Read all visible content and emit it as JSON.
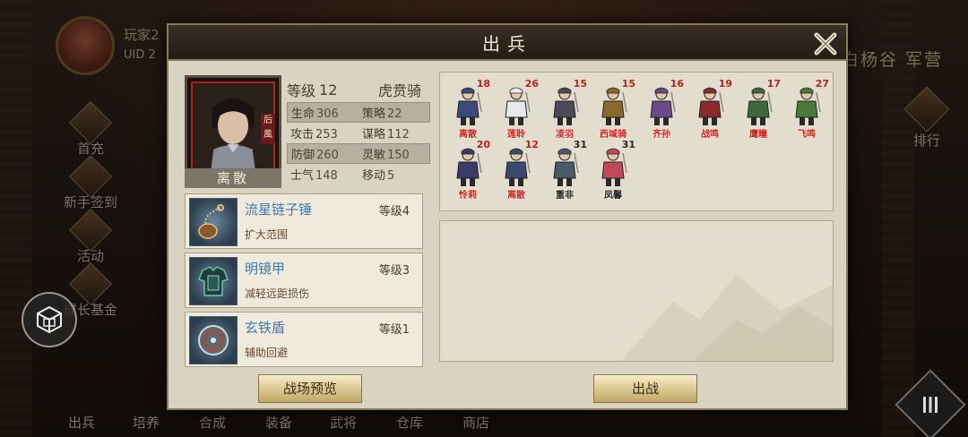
{
  "background": {
    "player_name": "玩家2",
    "player_uid": "UID 2",
    "location_title": "白杨谷  军营",
    "rank_label": "排行",
    "left_menu": [
      "首充",
      "新手签到",
      "活动",
      "成长基金"
    ],
    "bottom_menu": [
      "出兵",
      "培养",
      "合成",
      "装备",
      "武将",
      "仓库",
      "商店"
    ]
  },
  "dialog": {
    "title": "出兵",
    "close_label": "×"
  },
  "general": {
    "name": "离散",
    "level_label": "等级",
    "level": "12",
    "unit_class": "虎贲骑",
    "portrait_tag": "后風",
    "stats": [
      {
        "k": "生命",
        "v": "306",
        "k2": "策略",
        "v2": "22",
        "shaded": true
      },
      {
        "k": "攻击",
        "v": "253",
        "k2": "谋略",
        "v2": "112",
        "shaded": false
      },
      {
        "k": "防御",
        "v": "260",
        "k2": "灵敏",
        "v2": "150",
        "shaded": true
      },
      {
        "k": "士气",
        "v": "148",
        "k2": "移动",
        "v2": "5",
        "shaded": false
      }
    ]
  },
  "equipment": [
    {
      "name": "流星链子锤",
      "level": "等级4",
      "desc": "扩大范围",
      "icon": "meteor-hammer-icon"
    },
    {
      "name": "明镜甲",
      "level": "等级3",
      "desc": "减轻远距损伤",
      "icon": "armor-icon"
    },
    {
      "name": "玄铁盾",
      "level": "等级1",
      "desc": "辅助回避",
      "icon": "shield-icon"
    }
  ],
  "troops": [
    {
      "name": "离散",
      "level": "18",
      "color": "#3a4a7a",
      "dark": false
    },
    {
      "name": "莲聆",
      "level": "26",
      "color": "#e8e8ec",
      "dark": false
    },
    {
      "name": "凌羽",
      "level": "15",
      "color": "#4a4a5a",
      "dark": false
    },
    {
      "name": "西域骑",
      "level": "15",
      "color": "#8a6a2a",
      "dark": false
    },
    {
      "name": "齐孙",
      "level": "16",
      "color": "#6a4a8a",
      "dark": false
    },
    {
      "name": "战鸣",
      "level": "19",
      "color": "#8a2a2a",
      "dark": false
    },
    {
      "name": "鹰瞳",
      "level": "17",
      "color": "#3a6a3a",
      "dark": false
    },
    {
      "name": "飞鸣",
      "level": "27",
      "color": "#4a7a3a",
      "dark": false
    },
    {
      "name": "怜莉",
      "level": "20",
      "color": "#3a3a6a",
      "dark": false
    },
    {
      "name": "离散",
      "level": "12",
      "color": "#3a4a6a",
      "dark": false
    },
    {
      "name": "重非",
      "level": "31",
      "color": "#4a5a66",
      "dark": true
    },
    {
      "name": "凤馨",
      "level": "31",
      "color": "#c04a5a",
      "dark": true
    }
  ],
  "buttons": {
    "preview": "战场预览",
    "deploy": "出战"
  },
  "colors": {
    "dialog_bg": "#d9d3c2",
    "header_bg": "#2a221a",
    "equip_name": "#3c7ab0",
    "troop_name": "#d2201a"
  }
}
